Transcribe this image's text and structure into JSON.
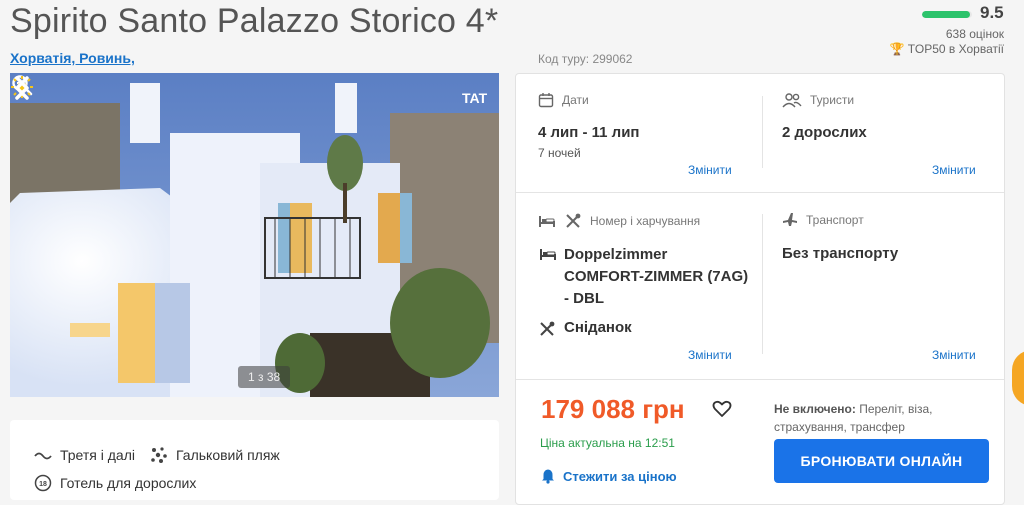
{
  "hotel": {
    "title": "Spirito Santo Palazzo Storico 4*",
    "location": "Хорватія, Ровинь,",
    "tour_code": "Код туру: 299062"
  },
  "rating": {
    "value": "9.5",
    "fraction": 0.95,
    "count": "638 оцінок",
    "top50": "TOP50 в Хорватії",
    "color": "#2cc36b"
  },
  "gallery": {
    "counter": "1 з 38",
    "logo_text": "TAT",
    "icons": [
      "zoom-icon",
      "chevron-left-icon",
      "chevron-right-icon"
    ]
  },
  "features": [
    {
      "icon": "wave-icon",
      "label": "Третя і далі"
    },
    {
      "icon": "pebbles-icon",
      "label": "Гальковий пляж"
    },
    {
      "icon": "adults-only-icon",
      "label": "Готель для дорослих"
    }
  ],
  "booking": {
    "dates": {
      "label": "Дати",
      "value": "4 лип - 11 лип",
      "nights": "7 ночей",
      "change": "Змінити"
    },
    "tourists": {
      "label": "Туристи",
      "value": "2 дорослих",
      "change": "Змінити"
    },
    "room_meal": {
      "label": "Номер і харчування",
      "room": "Doppelzimmer COMFORT-ZIMMER (7AG) - DBL",
      "meal": "Сніданок",
      "change": "Змінити"
    },
    "transport": {
      "label": "Транспорт",
      "value": "Без транспорту",
      "change": "Змінити"
    },
    "price": "179 088 грн",
    "price_color": "#f05a28",
    "actual": "Ціна актуальна на 12:51",
    "watch": "Стежити за ціною",
    "not_included_label": "Не включено:",
    "not_included": "Переліт, віза, страхування, трансфер",
    "book_button": "БРОНЮВАТИ ОНЛАЙН",
    "accent": "#1a73e8"
  }
}
